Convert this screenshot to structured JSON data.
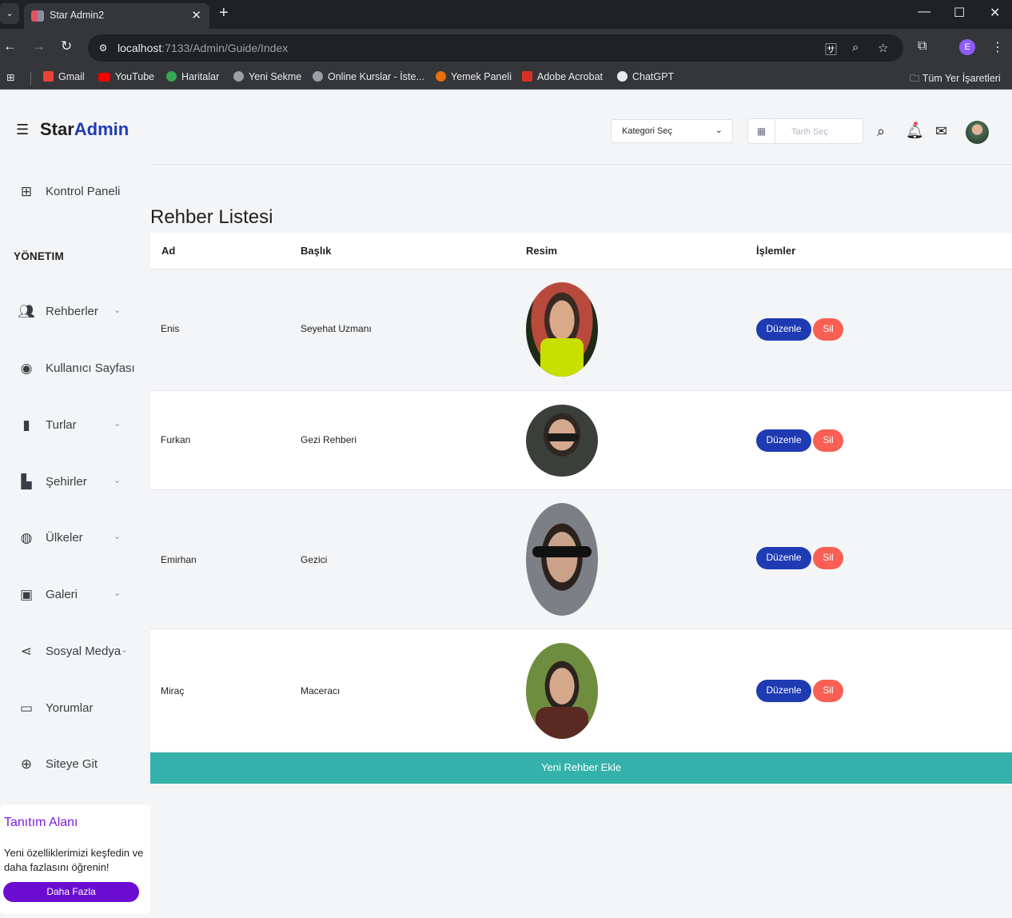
{
  "browser": {
    "tab_title": "Star Admin2",
    "url_host": "localhost",
    "url_path": ":7133/Admin/Guide/Index",
    "profile_initial": "E",
    "bookmarks": [
      {
        "label": "Gmail",
        "color": "#ea4335"
      },
      {
        "label": "YouTube",
        "color": "#ff0000"
      },
      {
        "label": "Haritalar",
        "color": "#34a853"
      },
      {
        "label": "Yeni Sekme",
        "color": "#9aa0a6"
      },
      {
        "label": "Online Kurslar - İste...",
        "color": "#9aa0a6"
      },
      {
        "label": "Yemek Paneli",
        "color": "#e8710a"
      },
      {
        "label": "Adobe Acrobat",
        "color": "#d93025"
      },
      {
        "label": "ChatGPT",
        "color": "#e8eaed"
      }
    ],
    "all_bookmarks": "Tüm Yer İşaretleri"
  },
  "header": {
    "brand_part1": "Star",
    "brand_part2": "Admin",
    "category_select": "Kategori Seç",
    "date_placeholder": "Tarih Seç"
  },
  "sidebar": {
    "dashboard": "Kontrol Paneli",
    "section_heading": "YÖNETIM",
    "items": [
      {
        "label": "Rehberler",
        "icon": "people-icon",
        "has_children": true
      },
      {
        "label": "Kullanıcı Sayfası",
        "icon": "account-icon",
        "has_children": false
      },
      {
        "label": "Turlar",
        "icon": "map-icon",
        "has_children": true
      },
      {
        "label": "Şehirler",
        "icon": "city-icon",
        "has_children": true
      },
      {
        "label": "Ülkeler",
        "icon": "globe-icon",
        "has_children": true
      },
      {
        "label": "Galeri",
        "icon": "image-icon",
        "has_children": true
      },
      {
        "label": "Sosyal Medya",
        "icon": "share-icon",
        "has_children": true
      },
      {
        "label": "Yorumlar",
        "icon": "comment-icon",
        "has_children": false
      },
      {
        "label": "Siteye Git",
        "icon": "web-icon",
        "has_children": false
      }
    ],
    "promo": {
      "title": "Tanıtım Alanı",
      "text": "Yeni özelliklerimizi keşfedin ve daha fazlasını öğrenin!",
      "button": "Daha Fazla"
    }
  },
  "main": {
    "title": "Rehber Listesi",
    "columns": [
      "Ad",
      "Başlık",
      "Resim",
      "İşlemler"
    ],
    "rows": [
      {
        "name": "Enis",
        "title": "Seyehat Uzmanı",
        "photo_bg": "#b84a3c",
        "edit": "Düzenle",
        "delete": "Sil"
      },
      {
        "name": "Furkan",
        "title": "Gezi Rehberi",
        "photo_bg": "#3a3f3a",
        "edit": "Düzenle",
        "delete": "Sil"
      },
      {
        "name": "Emirhan",
        "title": "Gezici",
        "photo_bg": "#7c7f85",
        "edit": "Düzenle",
        "delete": "Sil"
      },
      {
        "name": "Miraç",
        "title": "Maceracı",
        "photo_bg": "#6f8d3e",
        "edit": "Düzenle",
        "delete": "Sil"
      }
    ],
    "add_button": "Yeni Rehber Ekle"
  }
}
